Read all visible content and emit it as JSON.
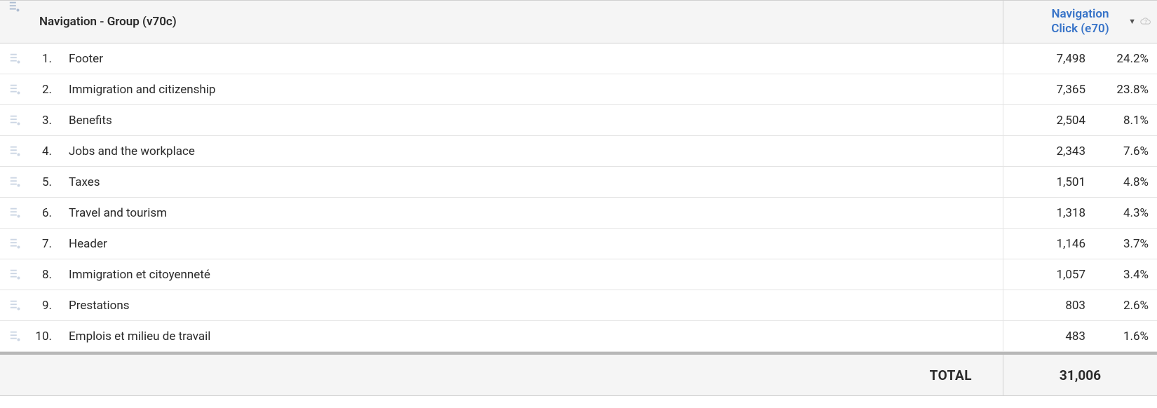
{
  "header": {
    "dimension_label": "Navigation - Group (v70c)",
    "metric_label_line1": "Navigation",
    "metric_label_line2": "Click (e70)"
  },
  "rows": [
    {
      "rank": "1.",
      "label": "Footer",
      "value": "7,498",
      "pct": "24.2%"
    },
    {
      "rank": "2.",
      "label": "Immigration and citizenship",
      "value": "7,365",
      "pct": "23.8%"
    },
    {
      "rank": "3.",
      "label": "Benefits",
      "value": "2,504",
      "pct": "8.1%"
    },
    {
      "rank": "4.",
      "label": "Jobs and the workplace",
      "value": "2,343",
      "pct": "7.6%"
    },
    {
      "rank": "5.",
      "label": "Taxes",
      "value": "1,501",
      "pct": "4.8%"
    },
    {
      "rank": "6.",
      "label": "Travel and tourism",
      "value": "1,318",
      "pct": "4.3%"
    },
    {
      "rank": "7.",
      "label": "Header",
      "value": "1,146",
      "pct": "3.7%"
    },
    {
      "rank": "8.",
      "label": "Immigration et citoyenneté",
      "value": "1,057",
      "pct": "3.4%"
    },
    {
      "rank": "9.",
      "label": "Prestations",
      "value": "803",
      "pct": "2.6%"
    },
    {
      "rank": "10.",
      "label": "Emplois et milieu de travail",
      "value": "483",
      "pct": "1.6%"
    }
  ],
  "total": {
    "label": "TOTAL",
    "value": "31,006"
  }
}
